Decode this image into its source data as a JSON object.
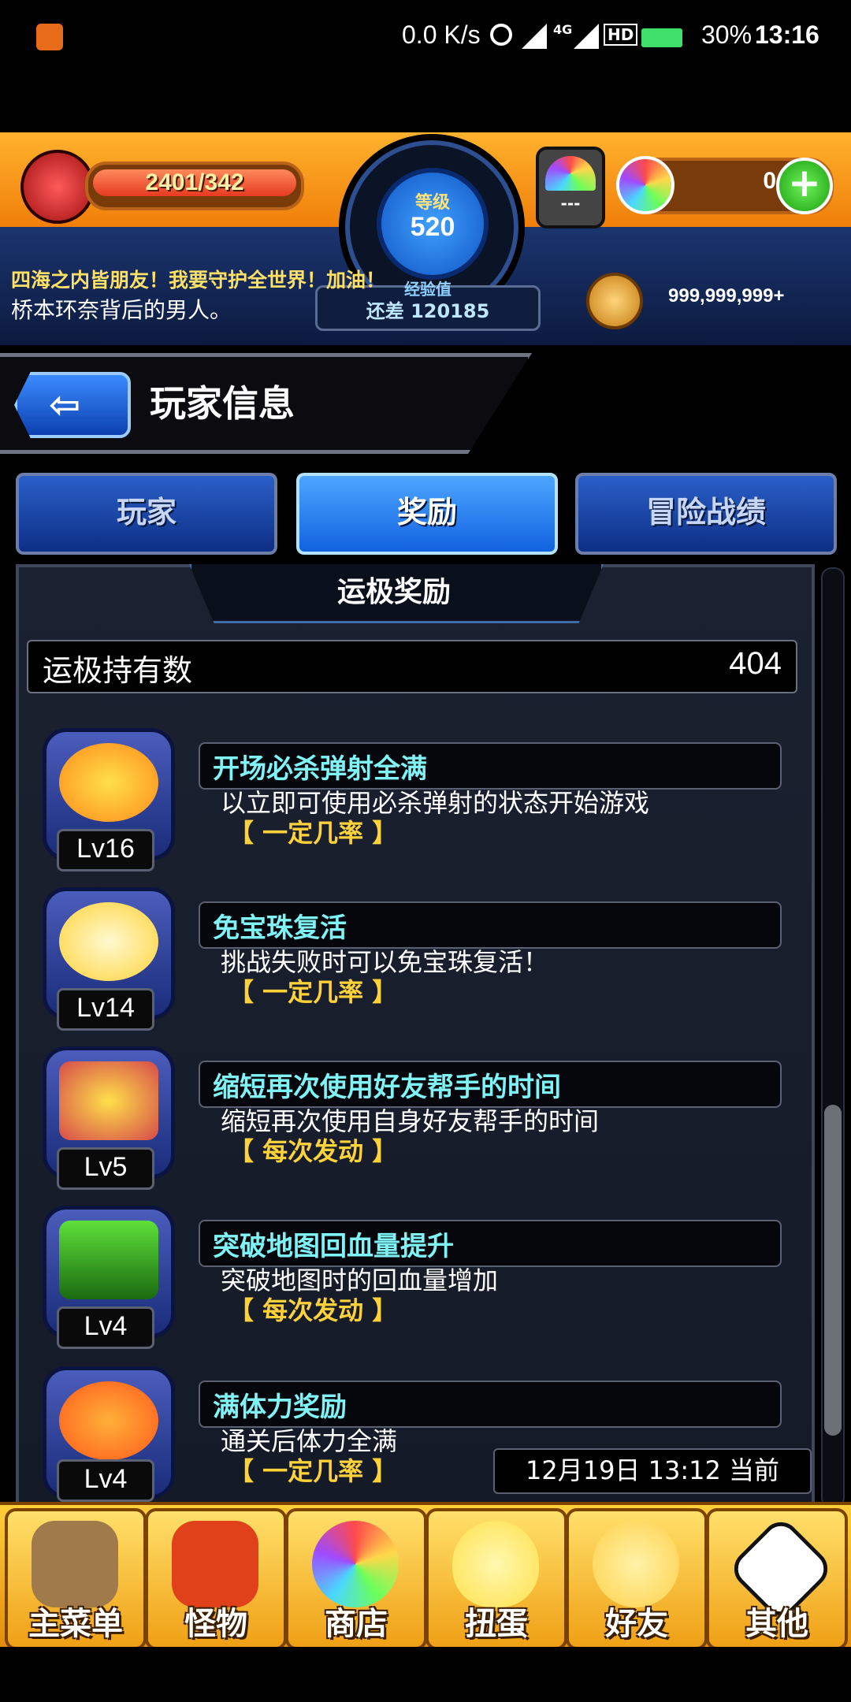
{
  "status_bar": {
    "net_speed": "0.0 K/s",
    "network": "4G",
    "hd": "HD",
    "battery": "30%",
    "time": "13:16"
  },
  "header": {
    "stamina": "2401/342",
    "level_label": "等级",
    "level": "520",
    "exp_label": "经验值",
    "exp_remaining": "还差 120185",
    "capsule_text": "---",
    "gems": "0",
    "add": "+",
    "message_line1": "四海之内皆朋友！我要守护全世界！加油！",
    "message_line2": "桥本环奈背后的男人。",
    "gold": "999,999,999+"
  },
  "title_bar": {
    "back_symbol": "⇦",
    "title": "玩家信息"
  },
  "tabs": [
    {
      "label": "玩家",
      "active": false
    },
    {
      "label": "奖励",
      "active": true
    },
    {
      "label": "冒险战绩",
      "active": false
    }
  ],
  "panel": {
    "title": "运极奖励",
    "count_label": "运极持有数",
    "count_value": "404",
    "timestamp": "12月19日 13:12 当前"
  },
  "rewards": [
    {
      "icon": "go-burst-icon",
      "level": "Lv16",
      "name": "开场必杀弹射全满",
      "desc": "以立即可使用必杀弹射的状态开始游戏",
      "chance": "【 一定几率 】",
      "icon_color": "#ff8a1a"
    },
    {
      "icon": "winged-arrow-icon",
      "level": "Lv14",
      "name": "免宝珠复活",
      "desc": "挑战失败时可以免宝珠复活！",
      "chance": "【 一定几率 】",
      "icon_color": "#ffd23a"
    },
    {
      "icon": "friend-clock-icon",
      "level": "Lv5",
      "name": "缩短再次使用好友帮手的时间",
      "desc": "缩短再次使用自身好友帮手的时间",
      "chance": "【 每次发动 】",
      "icon_color": "#d64a4a"
    },
    {
      "icon": "hp-arrow-icon",
      "level": "Lv4",
      "name": "突破地图回血量提升",
      "desc": "突破地图时的回血量增加",
      "chance": "【 每次发动 】",
      "icon_color": "#5ee03a"
    },
    {
      "icon": "stamina-arrow-icon",
      "level": "Lv4",
      "name": "满体力奖励",
      "desc": "通关后体力全满",
      "chance": "【 一定几率 】",
      "icon_color": "#ff5a1a"
    }
  ],
  "bottom_nav": [
    {
      "label": "主菜单",
      "icon": "castle-gate-icon",
      "color": "#a07a4a"
    },
    {
      "label": "怪物",
      "icon": "red-dragon-icon",
      "color": "#e0401a"
    },
    {
      "label": "商店",
      "icon": "rainbow-orb-icon",
      "color": "#7a7aff"
    },
    {
      "label": "扭蛋",
      "icon": "egg-icon",
      "color": "#ffe04a"
    },
    {
      "label": "好友",
      "icon": "friends-balloon-icon",
      "color": "#ffd04a"
    },
    {
      "label": "其他",
      "icon": "question-mark-icon",
      "color": "#ffffff"
    }
  ]
}
